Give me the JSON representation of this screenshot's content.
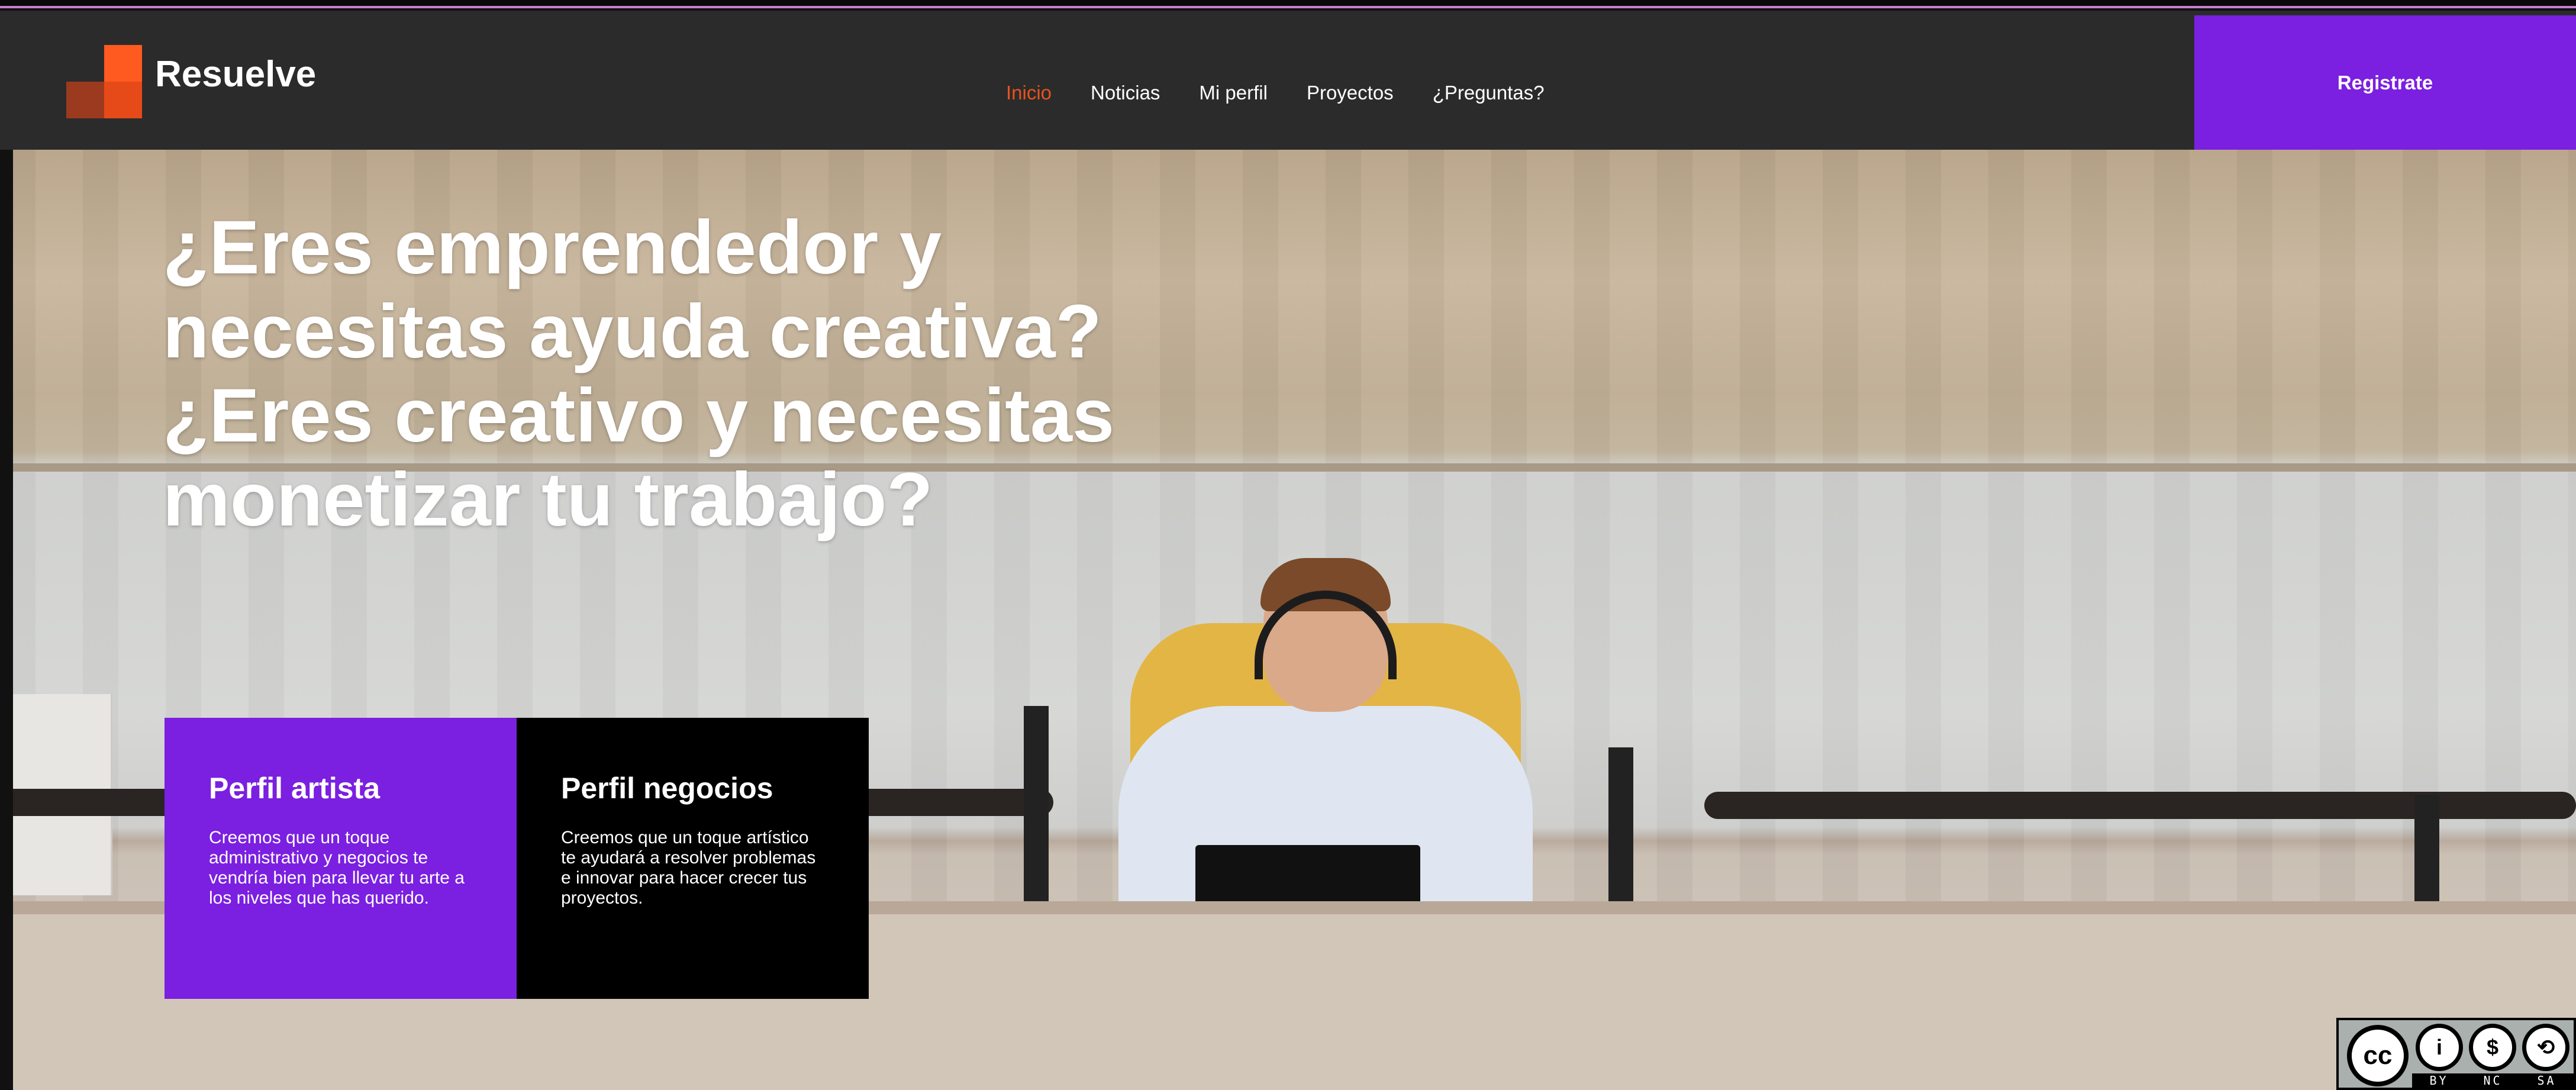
{
  "brand": {
    "name": "Resuelve"
  },
  "nav": {
    "items": [
      {
        "label": "Inicio",
        "active": true
      },
      {
        "label": "Noticias",
        "active": false
      },
      {
        "label": "Mi perfil",
        "active": false
      },
      {
        "label": "Proyectos",
        "active": false
      },
      {
        "label": "¿Preguntas?",
        "active": false
      }
    ],
    "register_label": "Registrate"
  },
  "hero": {
    "headline_lines": [
      "¿Eres emprendedor y",
      "necesitas ayuda creativa?",
      "¿Eres creativo y necesitas",
      "monetizar tu trabajo?"
    ]
  },
  "cards": {
    "artist": {
      "title": "Perfil artista",
      "text": "Creemos que un toque administrativo y negocios te vendría bien para llevar tu arte a los niveles que has querido."
    },
    "business": {
      "title": "Perfil negocios",
      "text": "Creemos que un toque artístico te ayudará a resolver problemas e innovar para hacer crecer tus proyectos."
    }
  },
  "license": {
    "cc": "cc",
    "by": "i",
    "nc": "$",
    "sa": "⟲",
    "strip": [
      "BY",
      "NC",
      "SA"
    ]
  },
  "colors": {
    "navbar_bg": "#2b2b2b",
    "accent_purple": "#7b1fe0",
    "active_link": "#e8531e",
    "logo_orange": "#ff5a1f"
  }
}
